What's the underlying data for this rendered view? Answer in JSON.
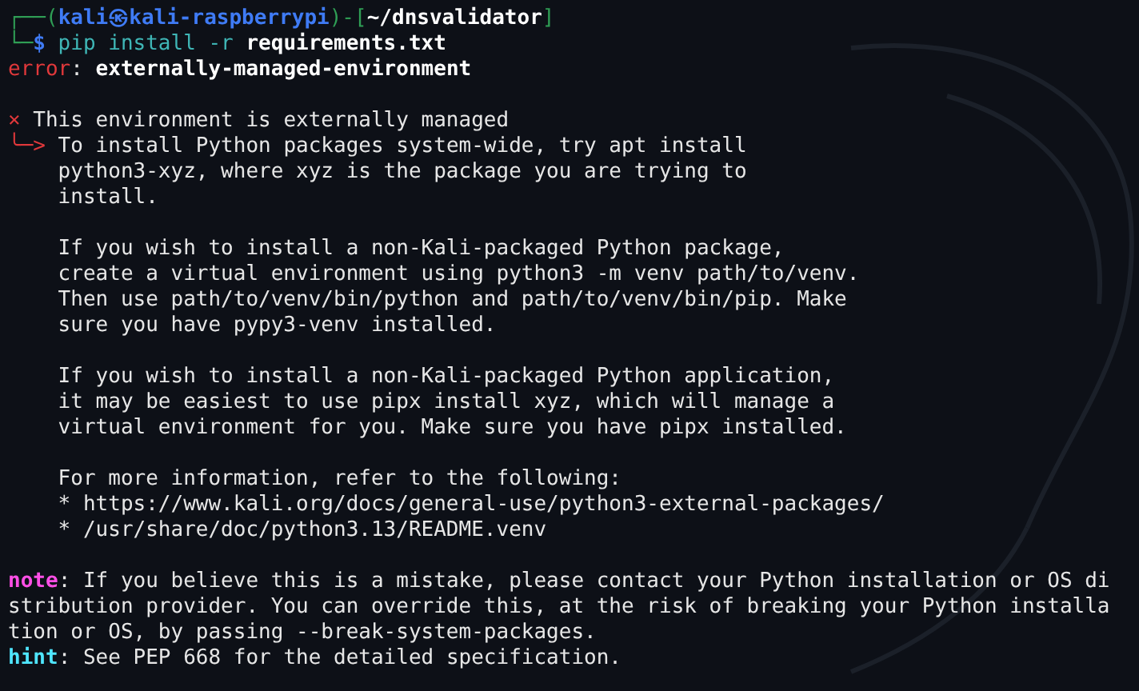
{
  "terminal": {
    "blocks": [
      {
        "lines": [
          {
            "segments": [
              {
                "text": "┌──(",
                "kind": "frame"
              },
              {
                "text": "kali㉿kali-raspberrypi",
                "kind": "host"
              },
              {
                "text": ")-[",
                "kind": "frame"
              },
              {
                "text": "~/dnsvalidator",
                "kind": "path"
              },
              {
                "text": "]",
                "kind": "frame"
              }
            ]
          },
          {
            "segments": [
              {
                "text": "└─",
                "kind": "frame"
              },
              {
                "text": "$",
                "kind": "host"
              },
              {
                "text": " pip install -r ",
                "kind": "command"
              },
              {
                "text": "requirements.txt",
                "kind": "bold"
              }
            ]
          },
          {
            "segments": [
              {
                "text": "error",
                "kind": "error"
              },
              {
                "text": ": ",
                "kind": "plain"
              },
              {
                "text": "externally-managed-environment",
                "kind": "bold"
              }
            ]
          }
        ]
      },
      {
        "lines": [
          {
            "segments": [
              {
                "text": "×",
                "kind": "error"
              },
              {
                "text": " This environment is externally managed",
                "kind": "plain"
              }
            ]
          },
          {
            "segments": [
              {
                "text": "╰─>",
                "kind": "error"
              },
              {
                "text": " To install Python packages system-wide, try apt install",
                "kind": "plain"
              }
            ]
          },
          {
            "segments": [
              {
                "text": "    python3-xyz, where xyz is the package you are trying to",
                "kind": "plain"
              }
            ]
          },
          {
            "segments": [
              {
                "text": "    install.",
                "kind": "plain"
              }
            ]
          }
        ]
      },
      {
        "lines": [
          {
            "segments": [
              {
                "text": "    If you wish to install a non-Kali-packaged Python package,",
                "kind": "plain"
              }
            ]
          },
          {
            "segments": [
              {
                "text": "    create a virtual environment using python3 -m venv path/to/venv.",
                "kind": "plain"
              }
            ]
          },
          {
            "segments": [
              {
                "text": "    Then use path/to/venv/bin/python and path/to/venv/bin/pip. Make",
                "kind": "plain"
              }
            ]
          },
          {
            "segments": [
              {
                "text": "    sure you have pypy3-venv installed.",
                "kind": "plain"
              }
            ]
          }
        ]
      },
      {
        "lines": [
          {
            "segments": [
              {
                "text": "    If you wish to install a non-Kali-packaged Python application,",
                "kind": "plain"
              }
            ]
          },
          {
            "segments": [
              {
                "text": "    it may be easiest to use pipx install xyz, which will manage a",
                "kind": "plain"
              }
            ]
          },
          {
            "segments": [
              {
                "text": "    virtual environment for you. Make sure you have pipx installed.",
                "kind": "plain"
              }
            ]
          }
        ]
      },
      {
        "lines": [
          {
            "segments": [
              {
                "text": "    For more information, refer to the following:",
                "kind": "plain"
              }
            ]
          },
          {
            "segments": [
              {
                "text": "    * https://www.kali.org/docs/general-use/python3-external-packages/",
                "kind": "plain"
              }
            ]
          },
          {
            "segments": [
              {
                "text": "    * /usr/share/doc/python3.13/README.venv",
                "kind": "plain"
              }
            ]
          }
        ]
      },
      {
        "lines": [
          {
            "segments": [
              {
                "text": "note",
                "kind": "note"
              },
              {
                "text": ": If you believe this is a mistake, please contact your Python installation or OS di",
                "kind": "plain"
              }
            ]
          },
          {
            "segments": [
              {
                "text": "stribution provider. You can override this, at the risk of breaking your Python installa",
                "kind": "plain"
              }
            ]
          },
          {
            "segments": [
              {
                "text": "tion or OS, by passing --break-system-packages.",
                "kind": "plain"
              }
            ]
          },
          {
            "segments": [
              {
                "text": "hint",
                "kind": "hint"
              },
              {
                "text": ": See PEP 668 for the detailed specification.",
                "kind": "plain"
              }
            ]
          }
        ]
      }
    ]
  }
}
